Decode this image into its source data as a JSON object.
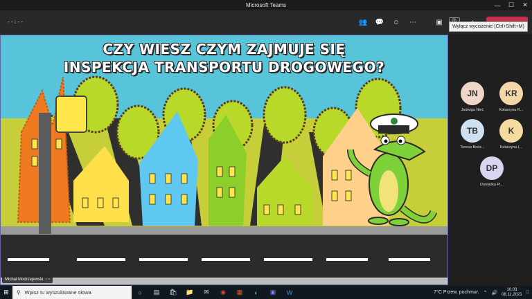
{
  "window": {
    "title": "Microsoft Teams",
    "minimize": "—",
    "maximize": "☐",
    "close": "✕"
  },
  "toolbar": {
    "timer": "--:--",
    "tooltip": "Wyłącz wyciszenie (Ctrl+Shift+M)"
  },
  "slide": {
    "title_line1": "CZY WIESZ CZYM ZAJMUJE SIĘ",
    "title_line2": "INSPEKCJA TRANSPORTU DROGOWEGO?"
  },
  "speaker": {
    "name": "Michał Modrzejewski"
  },
  "participants": [
    {
      "initials": "JN",
      "name": "Jadwiga Nieć",
      "color": "#f0d6c8"
    },
    {
      "initials": "KR",
      "name": "Katarzyna R...",
      "color": "#f4d7a8"
    },
    {
      "initials": "TB",
      "name": "Teresa Bodz...",
      "color": "#cfe0f0"
    },
    {
      "initials": "K",
      "name": "Katarzyna (...",
      "color": "#f4dca0"
    },
    {
      "initials": "DP",
      "name": "Dominika Pl...",
      "color": "#d9d4f0"
    }
  ],
  "taskbar": {
    "search_placeholder": "Wpisz tu wyszukiwane słowa",
    "weather": "7°C  Przew. pochmur.",
    "time": "10:03",
    "date": "08.11.2021"
  }
}
